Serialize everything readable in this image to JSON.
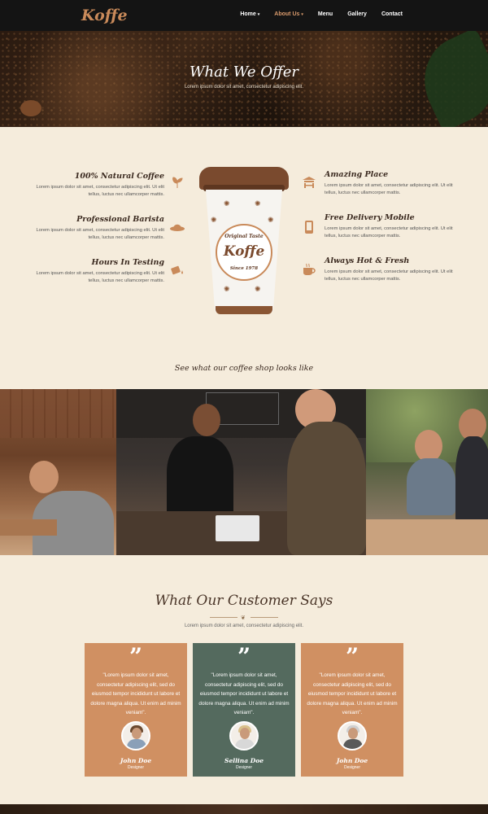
{
  "nav": {
    "logo": "Koffe",
    "items": [
      {
        "label": "Home",
        "caret": "▾",
        "active": false
      },
      {
        "label": "About Us",
        "caret": "▾",
        "active": true
      },
      {
        "label": "Menu",
        "caret": "",
        "active": false
      },
      {
        "label": "Gallery",
        "caret": "",
        "active": false
      },
      {
        "label": "Contact",
        "caret": "",
        "active": false
      }
    ]
  },
  "hero": {
    "title": "What We Offer",
    "subtitle": "Lorem ipsum dolor sit amet, consectetur adipiscing elit."
  },
  "features": {
    "left": [
      {
        "title": "100% Natural Coffee",
        "text": "Lorem ipsum dolor sit amet, consectetur adipiscing elit. Ut elit tellus, luctus nec ullamcorper mattis.",
        "icon": "leaf-icon"
      },
      {
        "title": "Professional Barista",
        "text": "Lorem ipsum dolor sit amet, consectetur adipiscing elit. Ut elit tellus, luctus nec ullamcorper mattis.",
        "icon": "hat-icon"
      },
      {
        "title": "Hours In Testing",
        "text": "Lorem ipsum dolor sit amet, consectetur adipiscing elit. Ut elit tellus, luctus nec ullamcorper mattis.",
        "icon": "pour-icon"
      }
    ],
    "right": [
      {
        "title": "Amazing Place",
        "text": "Lorem ipsum dolor sit amet, consectetur adipiscing elit. Ut elit tellus, luctus nec ullamcorper mattis.",
        "icon": "shop-icon"
      },
      {
        "title": "Free Delivery Mobile",
        "text": "Lorem ipsum dolor sit amet, consectetur adipiscing elit. Ut elit tellus, luctus nec ullamcorper mattis.",
        "icon": "mobile-icon"
      },
      {
        "title": "Always Hot & Fresh",
        "text": "Lorem ipsum dolor sit amet, consectetur adipiscing elit. Ut elit tellus, luctus nec ullamcorper mattis.",
        "icon": "cup-icon"
      }
    ]
  },
  "cup": {
    "badge_top": "Original Taste",
    "badge_main": "Koffe",
    "badge_bottom": "Since 1978"
  },
  "gallery": {
    "caption": "See what our coffee shop looks like"
  },
  "testimonials": {
    "title": "What Our Customer Says",
    "subtitle": "Lorem ipsum dolor sit amet, consectetur adipiscing elit.",
    "quote_mark": "”",
    "items": [
      {
        "quote": "\"Lorem ipsum dolor sit amet, consectetur adipiscing elit, sed do eiusmod tempor incididunt ut labore et dolore magna aliqua. Ut enim ad minim veniam\".",
        "name": "John Doe",
        "role": "Designer",
        "color": "#d09062"
      },
      {
        "quote": "\"Lorem ipsum dolor sit amet, consectetur adipiscing elit, sed do eiusmod tempor incididunt ut labore et dolore magna aliqua. Ut enim ad minim veniam\".",
        "name": "Sellina Doe",
        "role": "Designer",
        "color": "#546a5e"
      },
      {
        "quote": "\"Lorem ipsum dolor sit amet, consectetur adipiscing elit, sed do eiusmod tempor incididunt ut labore et dolore magna aliqua. Ut enim ad minim veniam\".",
        "name": "John Doe",
        "role": "Designer",
        "color": "#d09062"
      }
    ]
  },
  "colors": {
    "accent": "#c98a5a",
    "background": "#f5ecdc",
    "nav": "#141414",
    "card_green": "#546a5e"
  }
}
